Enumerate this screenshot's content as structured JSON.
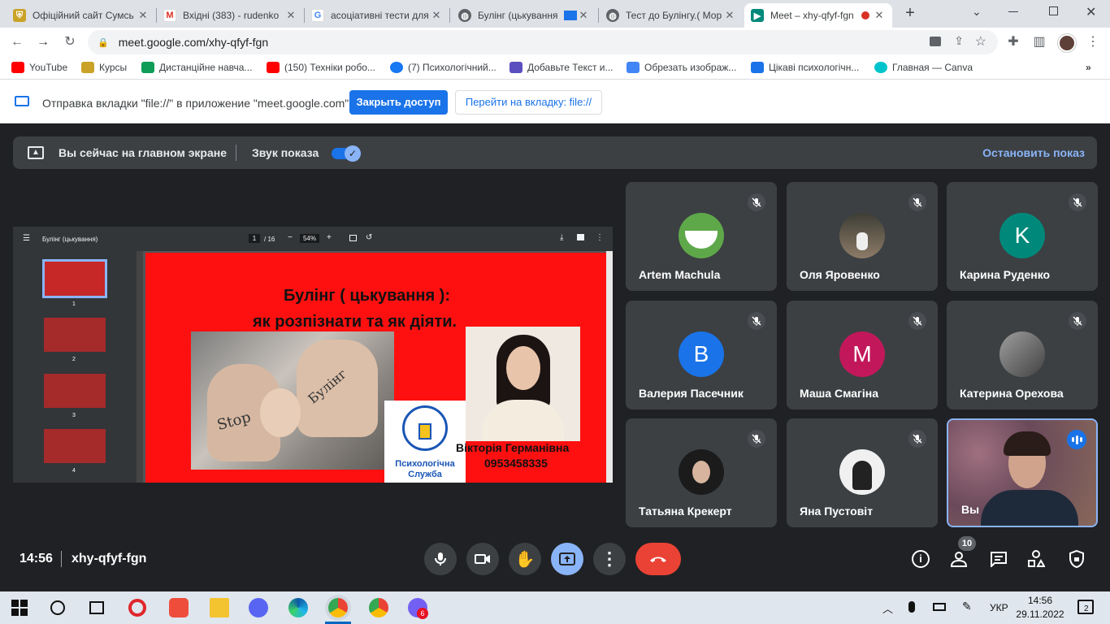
{
  "tabs": [
    {
      "title": "Офіційний сайт Сумсь",
      "color": "#c9a227"
    },
    {
      "title": "Вхідні (383) - rudenko",
      "color": "#d93025"
    },
    {
      "title": "асоціативні тести для",
      "color": "#4285f4"
    },
    {
      "title": "Булінг (цькування",
      "color": "#5f6368"
    },
    {
      "title": "Тест до Булінгу.( Мор",
      "color": "#5f6368"
    },
    {
      "title": "Meet – xhy-qfyf-fgn",
      "color": "#00897b"
    }
  ],
  "url": "meet.google.com/xhy-qfyf-fgn",
  "bookmarks": [
    {
      "label": "YouTube",
      "color": "#ff0000"
    },
    {
      "label": "Курсы",
      "color": "#c9a227"
    },
    {
      "label": "Дистанційне навча...",
      "color": "#0f9d58"
    },
    {
      "label": "(150) Техніки робо...",
      "color": "#ff0000"
    },
    {
      "label": "(7) Психологічний...",
      "color": "#1877f2"
    },
    {
      "label": "Добавьте Текст и...",
      "color": "#5b4fbf"
    },
    {
      "label": "Обрезать изображ...",
      "color": "#4285f4"
    },
    {
      "label": "Цікаві психологічн...",
      "color": "#1a73e8"
    },
    {
      "label": "Главная — Canva",
      "color": "#00c4cc"
    }
  ],
  "infobar": {
    "message": "Отправка вкладки \"file://\" в приложение \"meet.google.com\"...",
    "primary": "Закрыть доступ",
    "secondary": "Перейти на вкладку: file://"
  },
  "banner": {
    "main_screen": "Вы сейчас на главном экране",
    "sound": "Звук показа",
    "stop": "Остановить показ"
  },
  "pdf": {
    "title": "Булінг (цькування)",
    "page": "1",
    "pages": "/ 16",
    "zoom": "54%",
    "thumbs": [
      "1",
      "2",
      "3",
      "4"
    ]
  },
  "slide": {
    "title_line1": "Булінг ( цькування ):",
    "title_line2": "як розпізнати та як діяти.",
    "name": "Вікторія Германівна",
    "phone": "0953458335",
    "logo_text1": "Психологічна",
    "logo_text2": "Служба",
    "stop_text": "Stop",
    "bullying_text": "Булінг"
  },
  "participants": [
    {
      "name": "Artem Machula",
      "initial": "",
      "color": "#4caf50"
    },
    {
      "name": "Оля Яровенко",
      "initial": "",
      "color": "#8d7b68"
    },
    {
      "name": "Карина Руденко",
      "initial": "K",
      "color": "#00897b"
    },
    {
      "name": "Валерия Пасечник",
      "initial": "B",
      "color": "#1a73e8"
    },
    {
      "name": "Маша Смагіна",
      "initial": "M",
      "color": "#c2185b"
    },
    {
      "name": "Катерина Орехова",
      "initial": "",
      "color": "#6d6d6d"
    },
    {
      "name": "Татьяна Крекерт",
      "initial": "",
      "color": "#222222"
    },
    {
      "name": "Яна Пустовіт",
      "initial": "",
      "color": "#e0e0e0"
    },
    {
      "name": "Вы",
      "initial": "",
      "color": "#7a5a6a"
    }
  ],
  "meeting": {
    "time": "14:56",
    "code": "xhy-qfyf-fgn",
    "people_count": "10"
  },
  "taskbar": {
    "lang": "УКР",
    "time": "14:56",
    "date": "29.11.2022",
    "notifications": "2",
    "viber_badge": "6"
  }
}
